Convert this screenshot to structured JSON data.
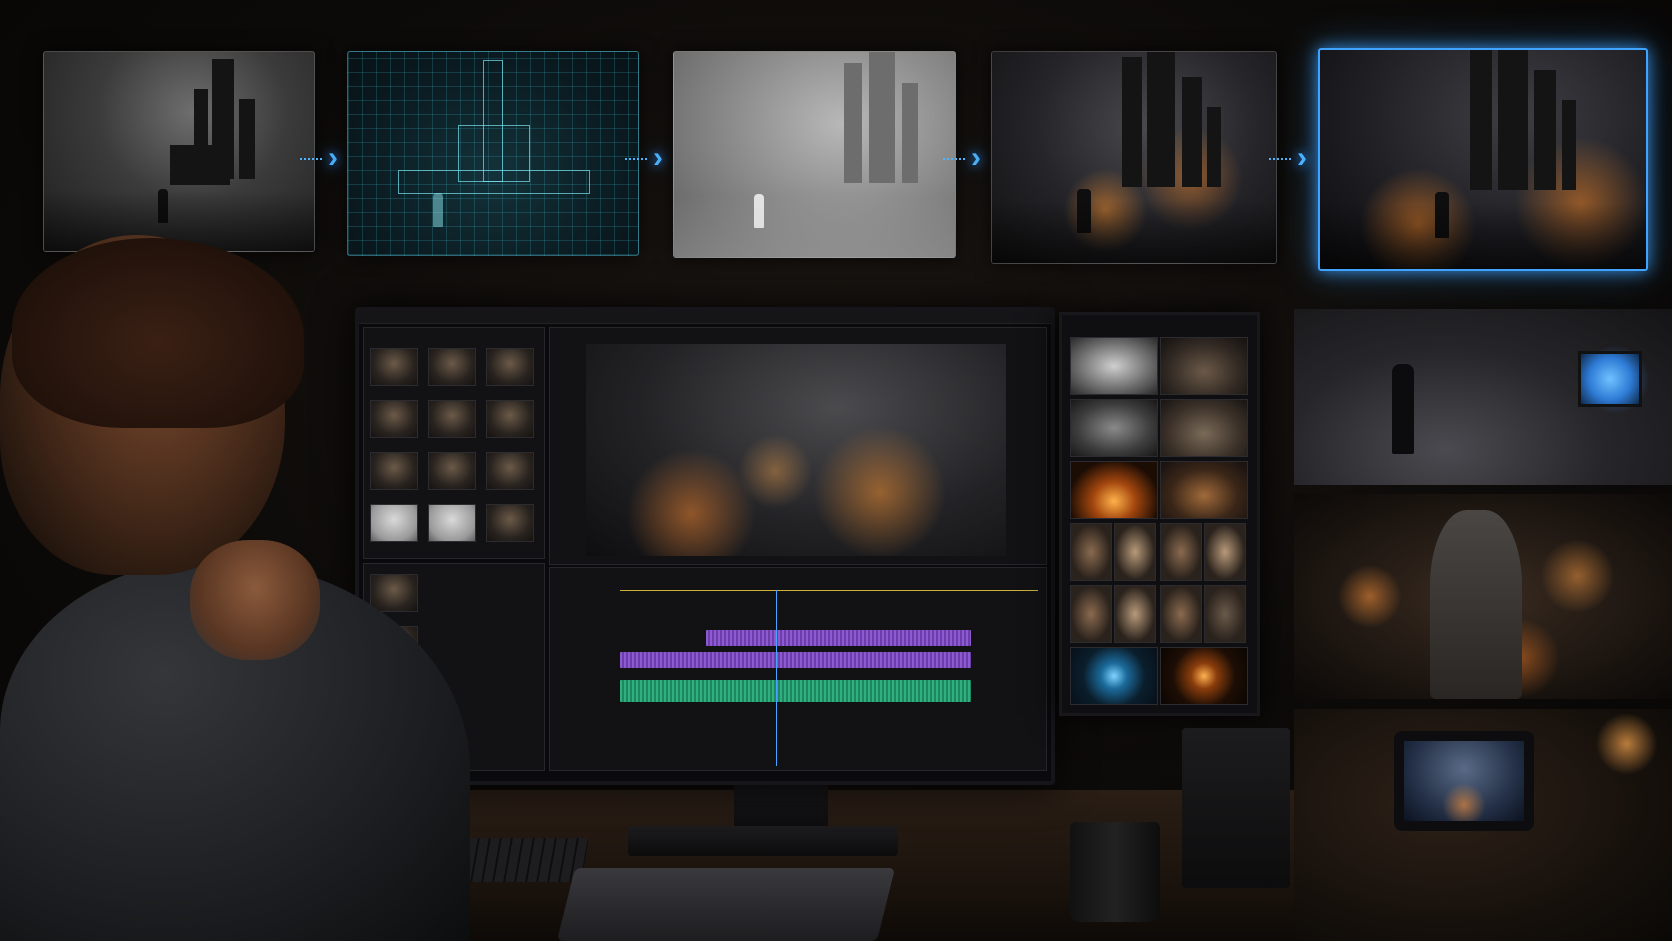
{
  "scene": {
    "description_free": true,
    "accent_color": "#3fa3ff",
    "fire_color": "#ff8a2a",
    "wireframe_color": "#5fd0e0"
  },
  "pipeline": {
    "stages": [
      {
        "icon": "concept-sketch"
      },
      {
        "icon": "wireframe-mesh"
      },
      {
        "icon": "grey-render"
      },
      {
        "icon": "lit-render"
      },
      {
        "icon": "final-composite"
      }
    ],
    "connector_icon": "chevron-right-icon"
  },
  "monitor": {
    "timeline_tracks": [
      {
        "color": "purple",
        "start": 0.3,
        "end": 0.96
      },
      {
        "color": "purple",
        "start": 0.0,
        "end": 0.96
      },
      {
        "color": "green",
        "start": 0.0,
        "end": 0.96
      }
    ]
  },
  "assets": {
    "icons": [
      "smoke-asset",
      "rock-asset",
      "dust-asset",
      "rubble-asset",
      "sunset-asset",
      "fire-figure-asset",
      "portal-asset",
      "spark-asset"
    ]
  }
}
